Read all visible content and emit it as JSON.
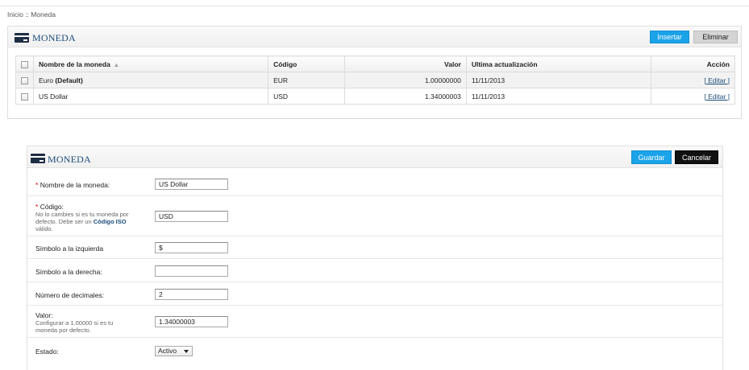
{
  "breadcrumb": "Inicio :: Moneda",
  "list_panel": {
    "title": "MONEDA",
    "insert_label": "Insertar",
    "delete_label": "Eliminar",
    "columns": [
      "Nombre de la moneda",
      "Código",
      "Valor",
      "Ultima actualización",
      "Acción"
    ],
    "sort_indicator": "▲",
    "rows": [
      {
        "name": "Euro",
        "suffix": "(Default)",
        "code": "EUR",
        "value": "1.00000000",
        "updated": "11/11/2013",
        "action": "[ Editar ]"
      },
      {
        "name": "US Dollar",
        "suffix": "",
        "code": "USD",
        "value": "1.34000003",
        "updated": "11/11/2013",
        "action": "[ Editar ]"
      }
    ]
  },
  "form_panel": {
    "title": "MONEDA",
    "save_label": "Guardar",
    "cancel_label": "Cancelar",
    "fields": {
      "name": {
        "label": "Nombre de la moneda:",
        "required": "*",
        "value": "US Dollar"
      },
      "code": {
        "label": "Código:",
        "required": "*",
        "hint_1": "No lo cambies si es tu moneda por",
        "hint_2": "defecto. Debe ser un",
        "hint_link": "Código ISO",
        "hint_3": "válido.",
        "value": "USD"
      },
      "symbol_left": {
        "label": "Símbolo a la izquierda",
        "value": "$"
      },
      "symbol_right": {
        "label": "Símbolo a la derecha:",
        "value": ""
      },
      "decimals": {
        "label": "Número de decimales:",
        "value": "2"
      },
      "rate": {
        "label": "Valor:",
        "hint_1": "Configurar a 1.00000 si es tu",
        "hint_2": "moneda por defecto.",
        "value": "1.34000003"
      },
      "status": {
        "label": "Estado:",
        "value": "Activo"
      }
    }
  },
  "colors": {
    "accent_blue": "#1aa3e8",
    "title_blue": "#1c4d7a",
    "required_red": "#dd0000"
  }
}
